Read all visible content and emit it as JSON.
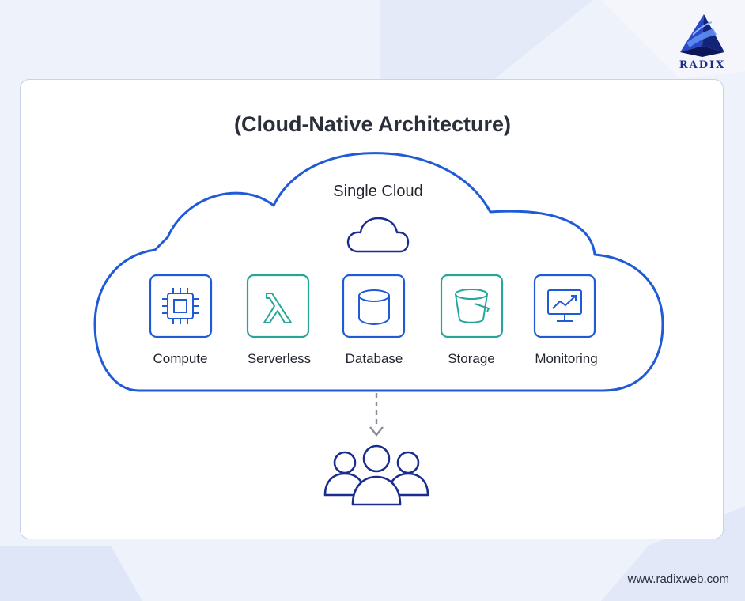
{
  "brand": {
    "logo_text": "RADIX",
    "website": "www.radixweb.com"
  },
  "diagram": {
    "title": "(Cloud-Native Architecture)",
    "cloud_label": "Single Cloud",
    "services": [
      {
        "label": "Compute",
        "icon": "cpu-chip-icon",
        "color": "#1f5bd6"
      },
      {
        "label": "Serverless",
        "icon": "lambda-icon",
        "color": "#26a69a"
      },
      {
        "label": "Database",
        "icon": "database-cylinder-icon",
        "color": "#1f5bd6"
      },
      {
        "label": "Storage",
        "icon": "storage-bucket-icon",
        "color": "#26a69a"
      },
      {
        "label": "Monitoring",
        "icon": "monitor-chart-icon",
        "color": "#1f5bd6"
      }
    ],
    "users_icon": "users-group-icon"
  },
  "colors": {
    "primary_blue": "#1f5bd6",
    "teal": "#26a69a",
    "navy": "#1a2d8f",
    "background": "#eef2fb"
  }
}
